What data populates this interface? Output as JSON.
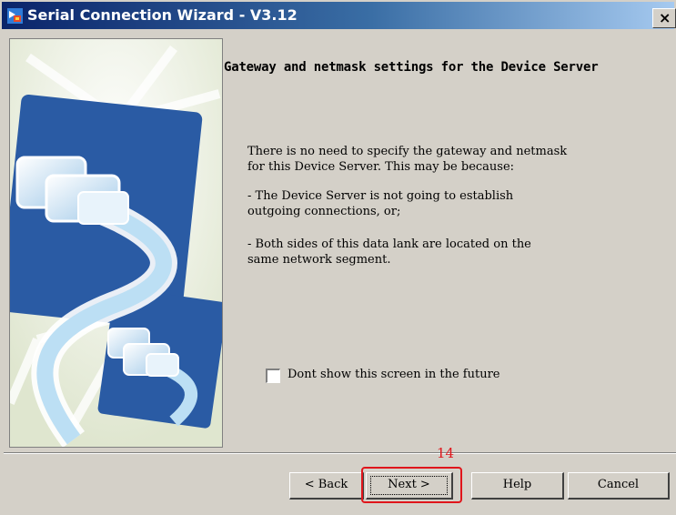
{
  "window": {
    "title": "Serial Connection Wizard - V3.12",
    "close_label": "×"
  },
  "page": {
    "heading": "Gateway and netmask settings for the Device Server",
    "message1": [
      "There is no need to specify the gateway and netmask",
      "for this Device Server. This may be because:"
    ],
    "message2": [
      "- The Device Server is not going to establish",
      "outgoing connections, or;"
    ],
    "message3": [
      "- Both sides of this data lank are located on the",
      "same network segment."
    ],
    "checkbox_label": "Dont show this screen in the future",
    "checkbox_checked": false
  },
  "buttons": {
    "back": "< Back",
    "next": "Next >",
    "help": "Help",
    "cancel": "Cancel"
  },
  "annotation": {
    "step_number": "14",
    "color": "#e0151b"
  },
  "colors": {
    "titlebar_start": "#0a246a",
    "titlebar_end": "#a6caf0",
    "dialog_face": "#d4d0c8",
    "illustration_blue": "#2a5ba4"
  },
  "icons": {
    "app": "network-connection-icon",
    "illustration": "serial-cable-illustration"
  }
}
